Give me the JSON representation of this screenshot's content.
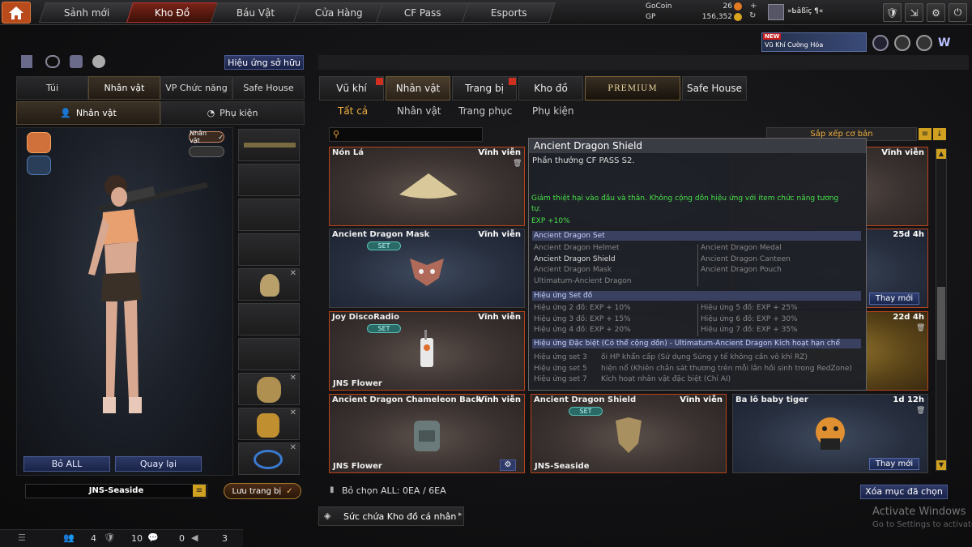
{
  "topnav": {
    "tabs": [
      "Sảnh mới",
      "Kho Đồ",
      "Báu Vật",
      "Cửa Hàng",
      "CF Pass",
      "Esports"
    ],
    "active_tab": "Kho Đồ"
  },
  "currency": {
    "gocoin_label": "GoCoin",
    "gocoin_value": "26",
    "gp_label": "GP",
    "gp_value": "156,352"
  },
  "player": {
    "name": "»Ƅâßïç ¶«"
  },
  "banner": {
    "tag": "NEW",
    "text": "Vũ Khí Cường Hóa"
  },
  "left": {
    "effects_button": "Hiệu ứng sở hữu",
    "tabs": [
      "Túi",
      "Nhân vật",
      "VP Chức năng",
      "Safe House"
    ],
    "active_tab": "Nhân vật",
    "subtabs": [
      "Nhân vật",
      "Phụ kiện"
    ],
    "active_subtab": "Nhân vật",
    "char_badge": "Nhân vật",
    "btn_remove_all": "Bỏ ALL",
    "btn_back": "Quay lại",
    "char_name": "JNS-Seaside",
    "save_button": "Lưu trang bị"
  },
  "right": {
    "tabs": [
      "Vũ khí",
      "Nhân vật",
      "Trang bị",
      "Kho đồ",
      "PREMIUM",
      "Safe House"
    ],
    "active_tab": "Nhân vật",
    "subtabs": [
      "Tất cả",
      "Nhân vật",
      "Trang phục",
      "Phụ kiện"
    ],
    "active_subtab": "Tất cả",
    "search_placeholder": "",
    "sort_label": "Sắp xếp cơ bản",
    "items": [
      {
        "name": "Nón Lá",
        "duration": "Vĩnh viễn",
        "owner": "",
        "set": false,
        "thay": ""
      },
      {
        "name": "",
        "duration": "",
        "owner": "",
        "set": false,
        "thay": ""
      },
      {
        "name": "",
        "duration": "Vĩnh viễn",
        "owner": "",
        "set": false,
        "thay": ""
      },
      {
        "name": "Ancient Dragon Mask",
        "duration": "Vĩnh viễn",
        "owner": "",
        "set": true,
        "thay": ""
      },
      {
        "name": "",
        "duration": "",
        "owner": "",
        "set": false,
        "thay": ""
      },
      {
        "name": "",
        "duration": "25d 4h",
        "owner": "",
        "set": false,
        "thay": "Thay mới"
      },
      {
        "name": "Joy DiscoRadio",
        "duration": "Vĩnh viễn",
        "owner": "JNS Flower",
        "set": true,
        "thay": ""
      },
      {
        "name": "",
        "duration": "",
        "owner": "",
        "set": false,
        "thay": ""
      },
      {
        "name": "",
        "duration": "22d 4h",
        "owner": "",
        "set": false,
        "thay": ""
      },
      {
        "name": "Ancient Dragon Chameleon Backpack",
        "duration": "Vĩnh viễn",
        "owner": "JNS Flower",
        "set": false,
        "thay": ""
      },
      {
        "name": "Ancient Dragon Shield",
        "duration": "Vĩnh viễn",
        "owner": "JNS-Seaside",
        "set": true,
        "thay": ""
      },
      {
        "name": "Ba lô baby tiger",
        "duration": "1d 12h",
        "owner": "",
        "set": false,
        "thay": "Thay mới"
      }
    ],
    "set_label": "SET",
    "deselect_all": "Bỏ chọn ALL: 0EA / 6EA",
    "delete_selected": "Xóa mục đã chọn",
    "capacity": "Sức chứa Kho đồ cá nhân"
  },
  "tooltip": {
    "title": "Ancient Dragon Shield",
    "source": "Phần thưởng CF PASS S2.",
    "desc1": "Giảm thiệt hại vào đầu và thân. Không cộng dồn hiệu ứng với item chức năng tương",
    "desc2": "tự.",
    "exp": "EXP +10%",
    "set_header": "Ancient Dragon Set",
    "set_items_left": [
      "Ancient Dragon Helmet",
      "Ancient Dragon Shield",
      "Ancient Dragon Mask",
      "Ultimatum-Ancient Dragon"
    ],
    "set_items_right": [
      "Ancient Dragon Medal",
      "Ancient Dragon Canteen",
      "Ancient Dragon Pouch"
    ],
    "effects_header": "Hiệu ứng Set đồ",
    "effects_left": [
      "Hiệu ứng 2 đồ: EXP + 10%",
      "Hiệu ứng 3 đồ: EXP + 15%",
      "Hiệu ứng 4 đồ: EXP + 20%"
    ],
    "effects_right": [
      "Hiệu ứng 5 đồ: EXP + 25%",
      "Hiệu ứng 6 đồ: EXP + 30%",
      "Hiệu ứng 7 đồ: EXP + 35%"
    ],
    "special_header": "Hiệu ứng Đặc biệt (Có thể cộng dồn) - Ultimatum-Ancient Dragon Kích hoạt hạn chế",
    "special_rows": [
      {
        "k": "Hiệu ứng set 3",
        "v": "ồi HP khẩn cấp (Sử dụng Súng y tế không cần vô khí RZ)"
      },
      {
        "k": "Hiệu ứng set 5",
        "v": "hiện nổ (Khiên chắn sát thương trên mỗi lần hồi sinh trong RedZone)"
      },
      {
        "k": "Hiệu ứng set 7",
        "v": "Kích hoạt nhân vật đặc biệt (Chỉ AI)"
      }
    ]
  },
  "bottombar": {
    "v1": "4",
    "v2": "10",
    "v3": "0",
    "v4": "3"
  },
  "watermark": {
    "line1": "Activate Windows",
    "line2": "Go to Settings to activate"
  }
}
